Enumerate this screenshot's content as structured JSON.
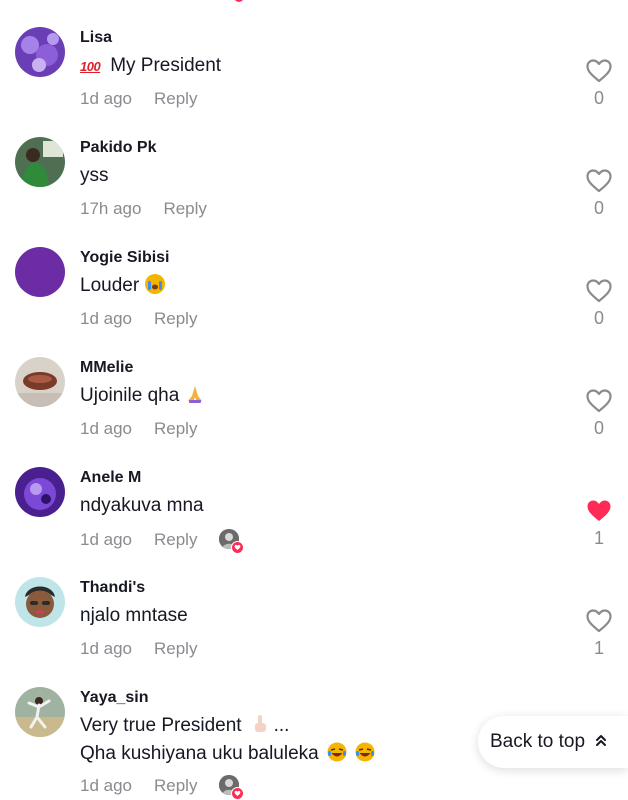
{
  "reply_label": "Reply",
  "back_to_top": {
    "label": "Back to top"
  },
  "comments": [
    {
      "username": "Lisa",
      "text": "My President",
      "time": "1d ago",
      "likes": "0",
      "liked": false
    },
    {
      "username": "Pakido Pk",
      "text": "yss",
      "time": "17h ago",
      "likes": "0",
      "liked": false
    },
    {
      "username": "Yogie Sibisi",
      "text": "Louder",
      "time": "1d ago",
      "likes": "0",
      "liked": false
    },
    {
      "username": "MMelie",
      "text": "Ujoinile qha",
      "time": "1d ago",
      "likes": "0",
      "liked": false
    },
    {
      "username": "Anele M",
      "text": "ndyakuva mna",
      "time": "1d ago",
      "likes": "1",
      "liked": true
    },
    {
      "username": "Thandi's",
      "text": "njalo mntase",
      "time": "1d ago",
      "likes": "1",
      "liked": false
    },
    {
      "username": "Yaya_sin",
      "text_line1": "Very true President",
      "text_line1_suffix": "...",
      "text_line2": "Qha kushiyana uku baluleka",
      "time": "1d ago"
    }
  ],
  "colors": {
    "like_active": "#fe2c55",
    "muted_text": "#8a8b91",
    "primary_text": "#161823"
  },
  "icons": [
    "heart-outline-icon",
    "heart-filled-icon",
    "chevron-up-double-icon",
    "emoji-100-icon",
    "emoji-crying-icon",
    "emoji-praying-hands-icon",
    "emoji-index-up-icon",
    "emoji-laughing-icon"
  ]
}
